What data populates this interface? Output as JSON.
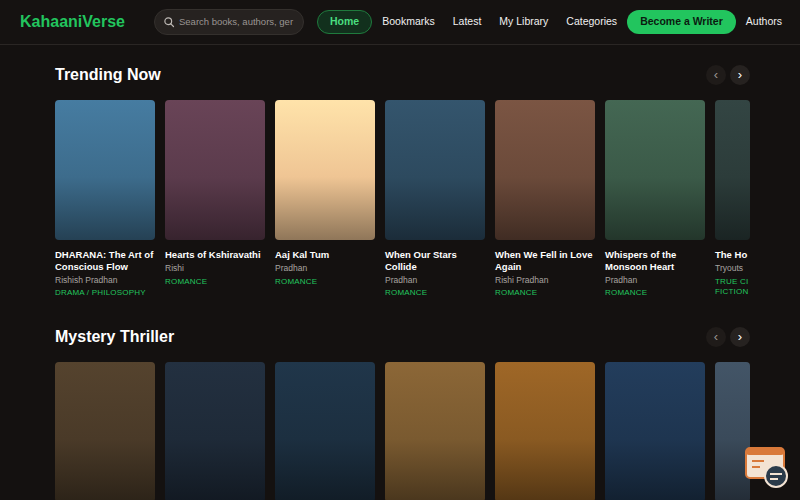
{
  "brand": "KahaaniVerse",
  "search": {
    "placeholder": "Search books, authors, ger"
  },
  "nav": [
    {
      "label": "Home",
      "selected": true,
      "kind": "link"
    },
    {
      "label": "Bookmarks",
      "selected": false,
      "kind": "link"
    },
    {
      "label": "Latest",
      "selected": false,
      "kind": "link"
    },
    {
      "label": "My Library",
      "selected": false,
      "kind": "link"
    },
    {
      "label": "Categories",
      "selected": false,
      "kind": "link"
    },
    {
      "label": "Become a Writer",
      "selected": false,
      "kind": "cta"
    },
    {
      "label": "Authors",
      "selected": false,
      "kind": "link"
    }
  ],
  "sections": [
    {
      "title": "Trending Now",
      "prev": "‹",
      "next": "›",
      "books": [
        {
          "title": "DHARANA: The Art of Conscious Flow",
          "author": "Rishish Pradhan",
          "genre": "DRAMA / PHILOSOPHY",
          "color": "#3d6c8c"
        },
        {
          "title": "Hearts of Kshiravathi",
          "author": "Rishi",
          "genre": "ROMANCE",
          "color": "#5b3b4c"
        },
        {
          "title": "Aaj Kal Tum",
          "author": "Pradhan",
          "genre": "ROMANCE",
          "color": "#efc594"
        },
        {
          "title": "When Our Stars Collide",
          "author": "Pradhan",
          "genre": "ROMANCE",
          "color": "#2d4a5f"
        },
        {
          "title": "When We Fell in Love Again",
          "author": "Rishi Pradhan",
          "genre": "ROMANCE",
          "color": "#6b4a3a"
        },
        {
          "title": "Whispers of the Monsoon Heart",
          "author": "Pradhan",
          "genre": "ROMANCE",
          "color": "#3b5a48"
        },
        {
          "title": "The Ho",
          "author": "Tryouts",
          "genre": "TRUE CI FICTION",
          "color": "#2c3c3a"
        }
      ]
    },
    {
      "title": "Mystery Thriller",
      "prev": "‹",
      "next": "›",
      "books": [
        {
          "color": "#4a3a28"
        },
        {
          "color": "#1e2a38"
        },
        {
          "color": "#1c2f40"
        },
        {
          "color": "#7a5a30"
        },
        {
          "color": "#8a5a22"
        },
        {
          "color": "#1e3550"
        },
        {
          "color": "#3a4a5a"
        }
      ]
    }
  ]
}
